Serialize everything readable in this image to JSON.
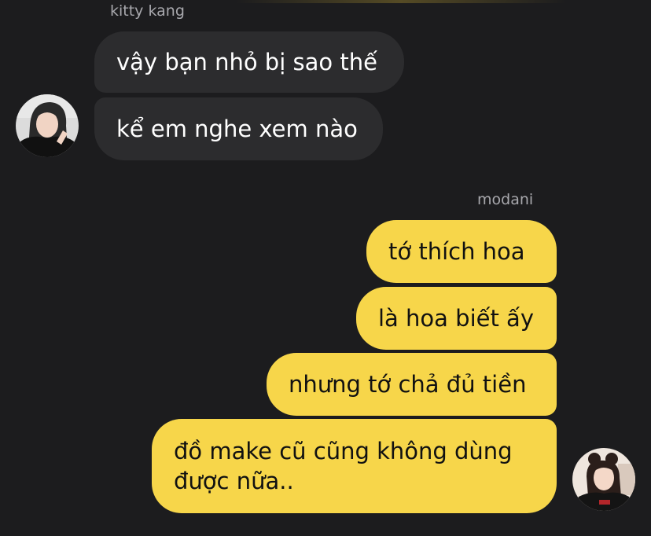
{
  "incoming": {
    "sender_name": "kitty kang",
    "messages": [
      "vậy bạn nhỏ bị sao thế",
      "kể em nghe xem nào"
    ],
    "avatar_icon": "user-avatar-photo"
  },
  "outgoing": {
    "sender_name": "modani",
    "messages": [
      "tớ thích hoa",
      "là hoa biết ấy",
      "nhưng tớ chả đủ tiền",
      "đồ make cũ cũng không dùng được nữa.."
    ],
    "avatar_icon": "user-avatar-photo"
  },
  "colors": {
    "background": "#1c1c1e",
    "incoming_bubble": "#2c2c2e",
    "outgoing_bubble": "#f7d64a",
    "name_text": "#a8a8ad"
  }
}
